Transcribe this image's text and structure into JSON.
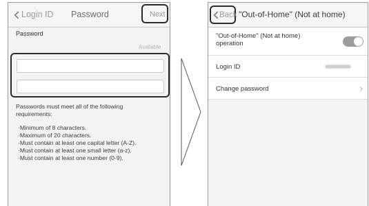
{
  "left_screen": {
    "nav": {
      "back_label": "Login ID",
      "title": "Password",
      "next_label": "Next"
    },
    "password_label": "Password",
    "available_text": "Available",
    "fields": [
      {
        "name": "password",
        "value": ""
      },
      {
        "name": "password-confirm",
        "value": ""
      }
    ],
    "requirements_intro": "Passwords must meet all of the following requirements:",
    "requirements": [
      "·Minimum of 8 characters.",
      "·Maximum of  20 characters.",
      "·Must contain at least one capital letter (A-Z).",
      "·Must contain at least one small letter (a-z).",
      "·Must contain at least one number (0-9)."
    ]
  },
  "right_screen": {
    "nav": {
      "back_label": "Back",
      "title": "\"Out-of-Home\" (Not at home)"
    },
    "rows": [
      {
        "label": "\"Out-of-Home\" (Not at home) operation",
        "toggle_on": true
      },
      {
        "label": "Login ID"
      },
      {
        "label": "Change password"
      }
    ]
  },
  "icons": {
    "back": "chevron-left-icon",
    "row_arrow": "chevron-right-icon",
    "transition": "right-arrow-icon"
  }
}
